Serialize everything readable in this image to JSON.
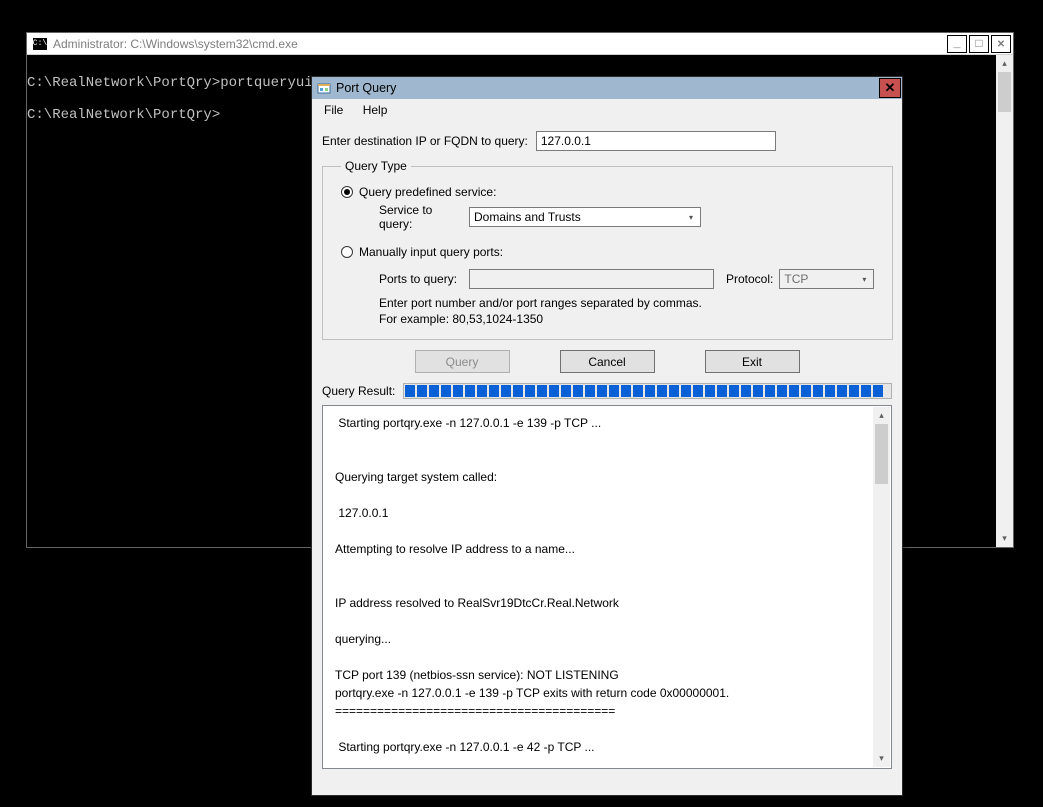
{
  "cmd": {
    "title": "Administrator: C:\\Windows\\system32\\cmd.exe",
    "icon_text": "C:\\",
    "lines": [
      "C:\\RealNetwork\\PortQry>portqueryui",
      "",
      "C:\\RealNetwork\\PortQry>"
    ],
    "controls": {
      "min": "_",
      "max": "□",
      "close": "✕"
    }
  },
  "pq": {
    "title": "Port Query",
    "menu": {
      "file": "File",
      "help": "Help"
    },
    "dest_label": "Enter destination IP or FQDN to query:",
    "dest_value": "127.0.0.1",
    "query_type_legend": "Query Type",
    "radio_predef_label": "Query predefined service:",
    "service_label": "Service to query:",
    "service_value": "Domains and Trusts",
    "radio_manual_label": "Manually input query ports:",
    "ports_label": "Ports to query:",
    "ports_value": "",
    "protocol_label": "Protocol:",
    "protocol_value": "TCP",
    "hint_line1": "Enter port number and/or port ranges separated by commas.",
    "hint_line2": "For example: 80,53,1024-1350",
    "buttons": {
      "query": "Query",
      "cancel": "Cancel",
      "exit": "Exit"
    },
    "result_label": "Query Result:",
    "result_text": " Starting portqry.exe -n 127.0.0.1 -e 139 -p TCP ...\n\n\nQuerying target system called:\n\n 127.0.0.1\n\nAttempting to resolve IP address to a name...\n\n\nIP address resolved to RealSvr19DtcCr.Real.Network\n\nquerying...\n\nTCP port 139 (netbios-ssn service): NOT LISTENING\nportqry.exe -n 127.0.0.1 -e 139 -p TCP exits with return code 0x00000001.\n========================================\n\n Starting portqry.exe -n 127.0.0.1 -e 42 -p TCP ..."
  }
}
